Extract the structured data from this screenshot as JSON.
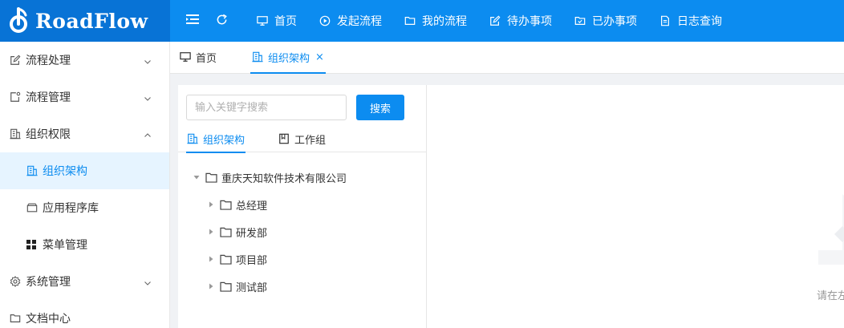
{
  "app": {
    "logo_text": "RoadFlow"
  },
  "topnav": {
    "items": [
      {
        "label": "首页",
        "icon": "monitor-icon"
      },
      {
        "label": "发起流程",
        "icon": "play-circle-icon"
      },
      {
        "label": "我的流程",
        "icon": "folder-icon"
      },
      {
        "label": "待办事项",
        "icon": "edit-icon"
      },
      {
        "label": "已办事项",
        "icon": "folder-check-icon"
      },
      {
        "label": "日志查询",
        "icon": "file-text-icon"
      }
    ]
  },
  "sidebar": {
    "items": [
      {
        "label": "流程处理",
        "icon": "edit-icon",
        "expanded": false
      },
      {
        "label": "流程管理",
        "icon": "settings-doc-icon",
        "expanded": false
      },
      {
        "label": "组织权限",
        "icon": "building-icon",
        "expanded": true
      },
      {
        "label": "组织架构",
        "icon": "building-icon",
        "active": true
      },
      {
        "label": "应用程序库",
        "icon": "inbox-icon"
      },
      {
        "label": "菜单管理",
        "icon": "grid-icon"
      },
      {
        "label": "系统管理",
        "icon": "gear-icon",
        "expanded": false
      },
      {
        "label": "文档中心",
        "icon": "folder-icon"
      }
    ]
  },
  "tabs": {
    "items": [
      {
        "label": "首页",
        "icon": "monitor-icon",
        "active": false
      },
      {
        "label": "组织架构",
        "icon": "building-icon",
        "active": true,
        "closable": true
      }
    ],
    "close_glyph": "×"
  },
  "search": {
    "placeholder": "输入关键字搜索",
    "value": "",
    "button_label": "搜索"
  },
  "inner_tabs": {
    "items": [
      {
        "label": "组织架构",
        "icon": "building-icon",
        "active": true
      },
      {
        "label": "工作组",
        "icon": "book-icon",
        "active": false
      }
    ]
  },
  "tree": {
    "root": "重庆天知软件技术有限公司",
    "children": [
      "总经理",
      "研发部",
      "项目部",
      "测试部"
    ]
  },
  "right_panel": {
    "hint": "请在左"
  },
  "colors": {
    "primary": "#0c8cf0",
    "logo_bg": "#0873d6",
    "active_bg": "#e6f4ff"
  }
}
